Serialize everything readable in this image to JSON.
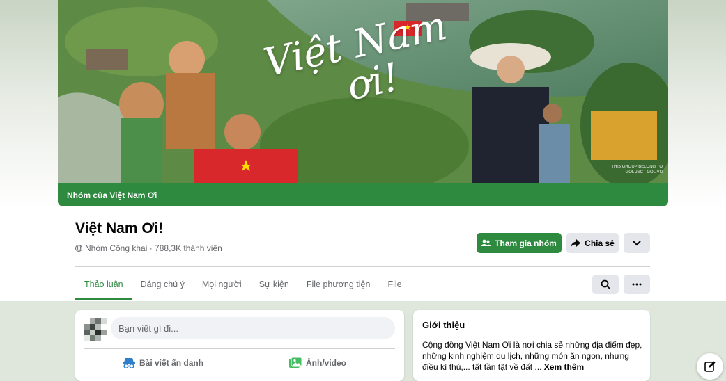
{
  "cover": {
    "strip_label": "Nhóm của Việt Nam Ơi",
    "art_text_line1": "Việt Nam",
    "art_text_line2": "ơi!",
    "credit_line1": "THIS GROUP BELONG TO",
    "credit_line2": "GOL JSC - GOL.VN"
  },
  "group": {
    "title": "Việt Nam Ơi!",
    "meta": "Nhóm Công khai · 788,3K thành viên"
  },
  "actions": {
    "join_label": "Tham gia nhóm",
    "share_label": "Chia sẻ"
  },
  "tabs": [
    {
      "label": "Thảo luận",
      "active": true
    },
    {
      "label": "Đáng chú ý"
    },
    {
      "label": "Mọi người"
    },
    {
      "label": "Sự kiện"
    },
    {
      "label": "File phương tiện"
    },
    {
      "label": "File"
    }
  ],
  "composer": {
    "placeholder": "Bạn viết gì đi...",
    "anon_label": "Bài viết ẩn danh",
    "photo_label": "Ảnh/video"
  },
  "intro": {
    "title": "Giới thiệu",
    "text": "Cộng đồng Việt Nam Ơi là nơi chia sẻ những địa điểm đẹp, những kinh nghiệm du lịch, những món ăn ngon, nhưng điều kì thú,... tất tần tật về đất ...",
    "see_more": "Xem thêm"
  },
  "colors": {
    "accent": "#2e8a3e",
    "button_gray": "#e4e6eb",
    "text_secondary": "#65676b"
  },
  "icons": [
    "globe-icon",
    "people-icon",
    "share-arrow-icon",
    "chevron-down-icon",
    "search-icon",
    "more-dots-icon",
    "incognito-icon",
    "photo-icon",
    "compose-icon"
  ]
}
